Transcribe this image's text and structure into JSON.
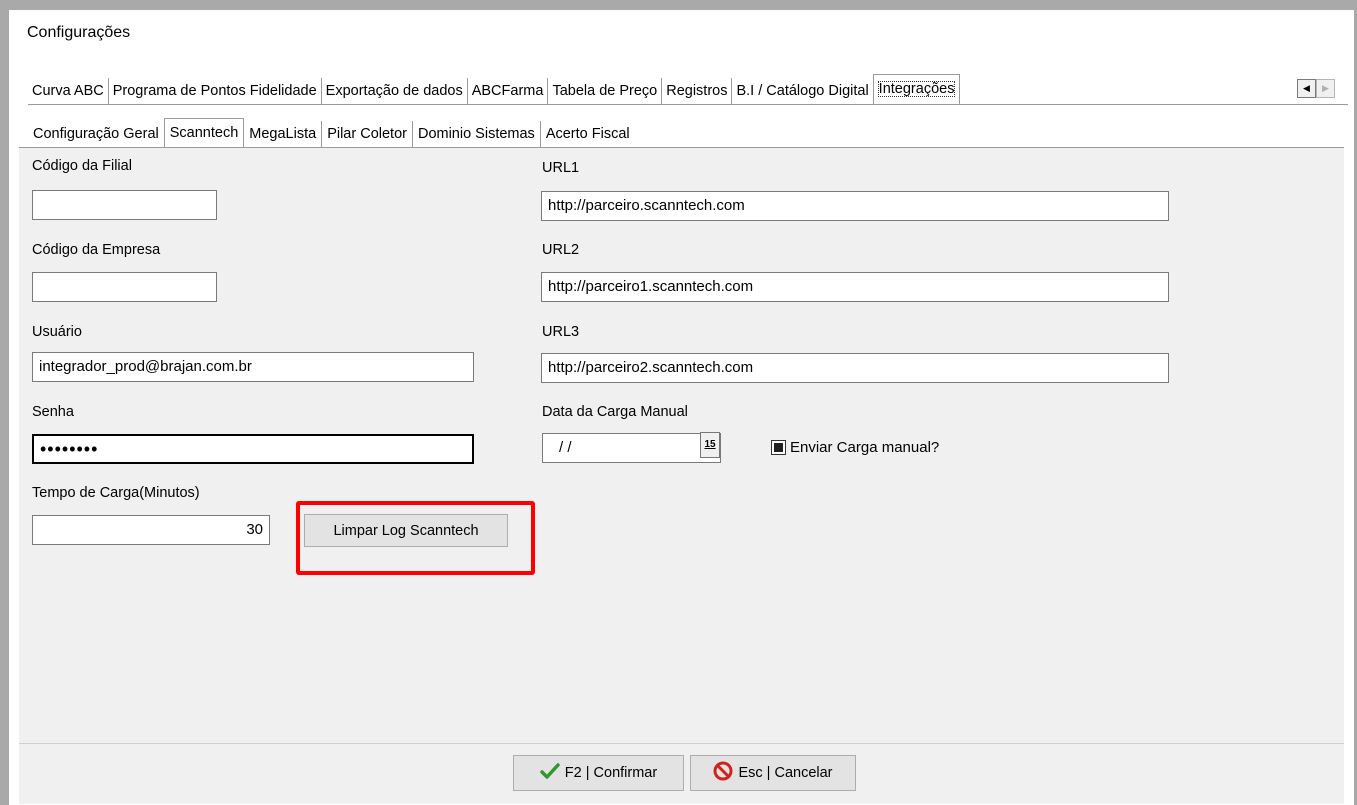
{
  "window": {
    "title": "Configurações"
  },
  "top_tabs": [
    "Curva ABC",
    "Programa de Pontos Fidelidade",
    "Exportação de dados",
    "ABCFarma",
    "Tabela de Preço",
    "Registros",
    "B.I / Catálogo Digital",
    "Integrações"
  ],
  "sub_tabs": [
    "Configuração Geral",
    "Scanntech",
    "MegaLista",
    "Pilar Coletor",
    "Dominio Sistemas",
    "Acerto Fiscal"
  ],
  "form": {
    "codigo_filial": {
      "label": "Código da Filial",
      "value": ""
    },
    "codigo_empresa": {
      "label": "Código da Empresa",
      "value": ""
    },
    "usuario": {
      "label": "Usuário",
      "value": "integrador_prod@brajan.com.br"
    },
    "senha": {
      "label": "Senha",
      "value": "••••••••"
    },
    "tempo_carga": {
      "label": "Tempo de Carga(Minutos)",
      "value": "30"
    },
    "url1": {
      "label": "URL1",
      "value": "http://parceiro.scanntech.com"
    },
    "url2": {
      "label": "URL2",
      "value": "http://parceiro1.scanntech.com"
    },
    "url3": {
      "label": "URL3",
      "value": "http://parceiro2.scanntech.com"
    },
    "data_carga": {
      "label": "Data da Carga Manual",
      "value": "/ /",
      "calendar_glyph": "15"
    },
    "enviar_carga": {
      "label": "Enviar Carga manual?",
      "checked": "indeterminate"
    },
    "limpar_log_label": "Limpar Log Scanntech"
  },
  "footer": {
    "confirm_label": "F2 | Confirmar",
    "cancel_label": "Esc | Cancelar",
    "confirm_icon": "check-icon",
    "cancel_icon": "no-entry-icon"
  },
  "colors": {
    "highlight": "#ff0000",
    "panel": "#f0f0f0",
    "check": "#2e9a2e",
    "cancel": "#d32020"
  }
}
